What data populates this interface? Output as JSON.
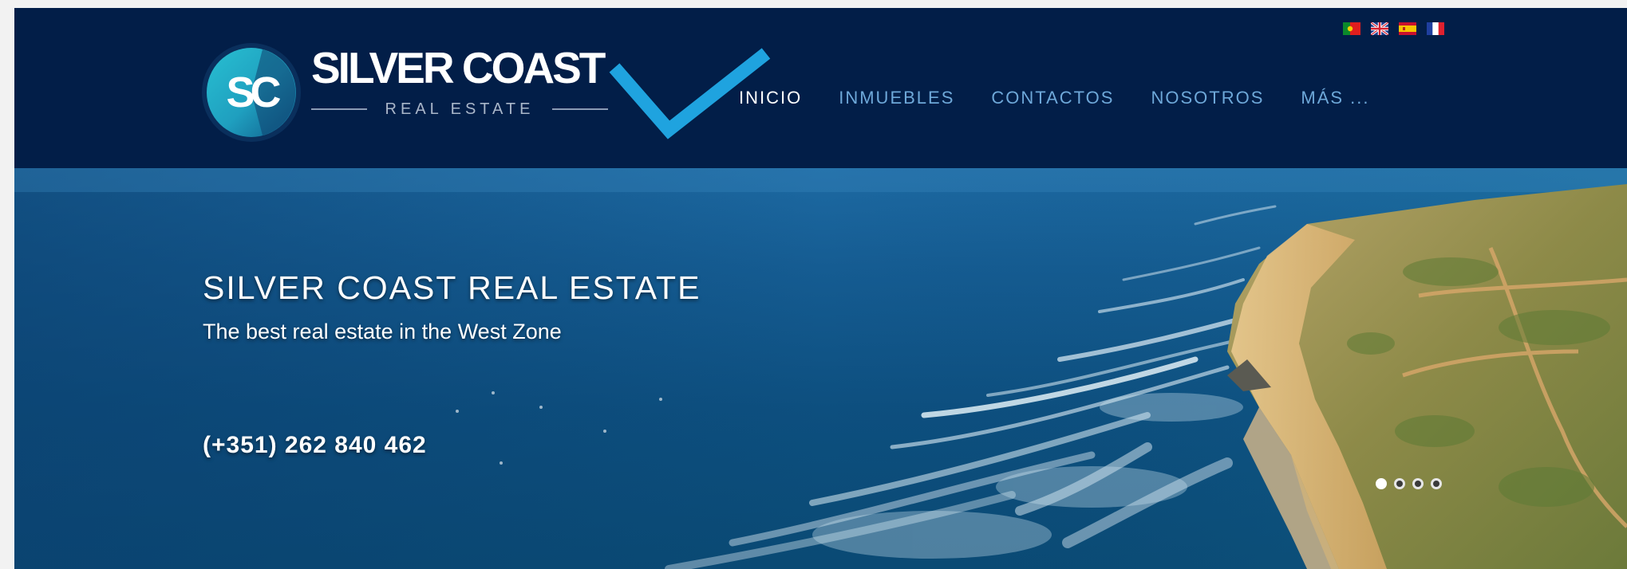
{
  "brand": {
    "logo_initials": "SC",
    "name": "SILVER COAST",
    "tagline": "REAL ESTATE"
  },
  "nav": {
    "items": [
      {
        "label": "INICIO",
        "active": true
      },
      {
        "label": "INMUEBLES",
        "active": false
      },
      {
        "label": "CONTACTOS",
        "active": false
      },
      {
        "label": "NOSOTROS",
        "active": false
      },
      {
        "label": "MÁS ...",
        "active": false
      }
    ]
  },
  "languages": [
    {
      "name": "portugal-flag-icon"
    },
    {
      "name": "uk-flag-icon"
    },
    {
      "name": "spain-flag-icon"
    },
    {
      "name": "france-flag-icon"
    }
  ],
  "hero": {
    "title": "SILVER COAST REAL ESTATE",
    "subtitle": "The best real estate in the West Zone",
    "phone": "(+351) 262 840 462",
    "slides": 4,
    "active_slide": 1
  },
  "colors": {
    "header_bg": "#021e48",
    "nav_text": "#6ea8d9",
    "nav_active": "#ffffff",
    "checkmark": "#1fa3df",
    "logo_teal": "#2bb6c9"
  }
}
